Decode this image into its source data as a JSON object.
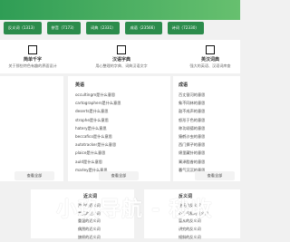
{
  "top_tabs": [
    {
      "label": "反义词（1313）"
    },
    {
      "label": "拼音（7173）"
    },
    {
      "label": "词典（2331）"
    },
    {
      "label": "成语（23566）"
    },
    {
      "label": "诗词（72330）"
    }
  ],
  "nav": [
    {
      "name": "简单千字",
      "desc": "关于那些特色有趣的界面设计"
    },
    {
      "name": "汉语字典",
      "desc": "用心整理的字典、词典汉语文字"
    },
    {
      "name": "英汉词典",
      "desc": "强大的英语、汉语词库查"
    }
  ],
  "panel_english": {
    "title": "英语",
    "items": [
      "occultingm是什么意思",
      "cartographers是什么意思",
      "deserts是什么意思",
      "strophe是什么意思",
      "hatery是什么意思",
      "beccafico是什么意思",
      "autotracker是什么意思",
      "plaice是什么意思",
      "auld是什么意思",
      "marley是什么意思"
    ],
    "button": "查看全部"
  },
  "panel_idioms": {
    "title": "成语",
    "items": [
      "百丈银河的意思",
      "象不同林的意思",
      "鼓不成声的意思",
      "怒形于色的意思",
      "称功颂德的意思",
      "猿鹤沙虫的意思",
      "西门掷子的意思",
      "绵里藏针的意思",
      "膏泽脂香的意思",
      "暮气沉沉的意思"
    ],
    "button": "查看全部"
  },
  "left_button": "查看全部",
  "bottom_left": {
    "title": "近义词",
    "items": [
      "游轮的近义词",
      "素质的近义词",
      "重温的近义词",
      "偶然的近义词",
      "旗帜的近义词"
    ]
  },
  "bottom_right": {
    "title": "反义词",
    "items": [
      "整天的反义词",
      "心平气和的反义词",
      "盲从的反义词",
      "讲究的反义词",
      "倾斜的反义词"
    ]
  },
  "watermark": "小玖导航 - 秒收"
}
